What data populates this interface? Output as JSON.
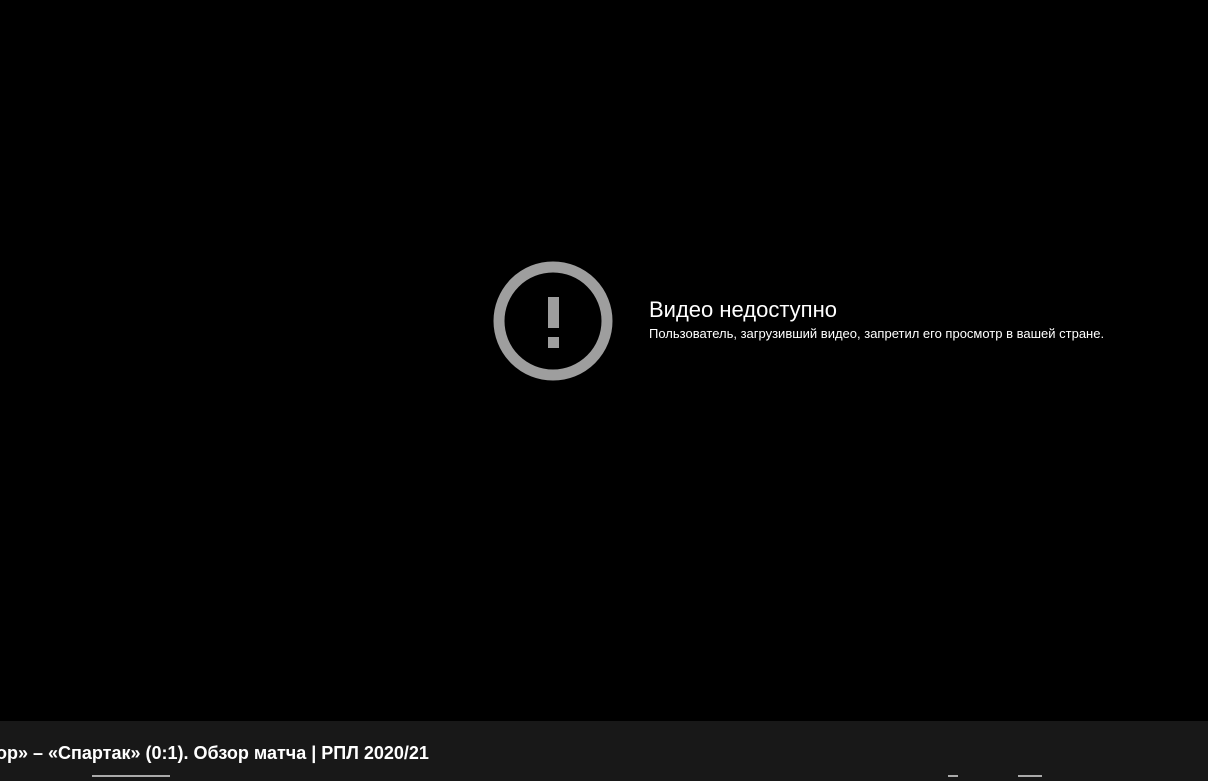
{
  "player": {
    "error_title": "Видео недоступно",
    "error_reason": "Пользователь, загрузивший видео, запретил его просмотр в вашей стране.",
    "error_icon": "alert-circle-icon",
    "icon_color": "#9e9e9e"
  },
  "video": {
    "title": "ор» – «Спартак» (0:1). Обзор матча | РПЛ 2020/21"
  },
  "colors": {
    "background": "#000000",
    "info_bar": "#181818",
    "text": "#ffffff",
    "secondary_text": "#aaaaaa"
  }
}
